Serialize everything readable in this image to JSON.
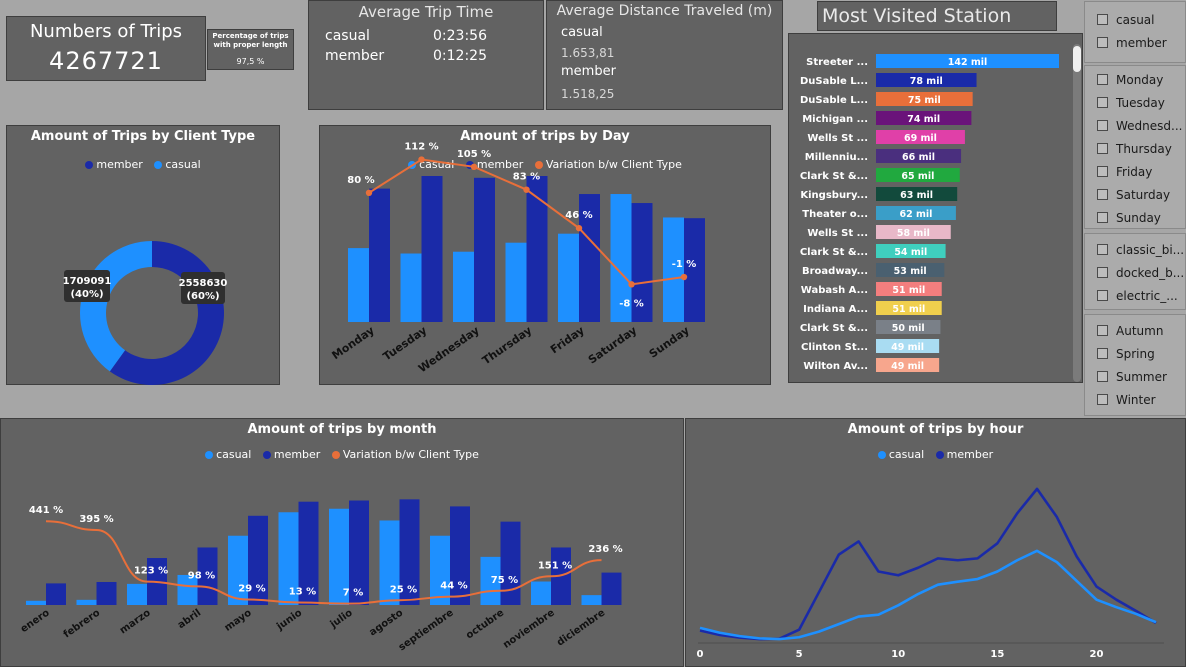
{
  "colors": {
    "casual": "#1e90ff",
    "member": "#1a2aa8",
    "variation": "#e86f3a",
    "panel": "#626262"
  },
  "kpi": {
    "trips_title": "Numbers of Trips",
    "trips_value": "4267721",
    "pct_label": "Percentage of trips with proper length",
    "pct_value": "97,5 %"
  },
  "avg_time": {
    "title": "Average Trip Time",
    "rows": [
      {
        "label": "casual",
        "value": "0:23:56"
      },
      {
        "label": "member",
        "value": "0:12:25"
      }
    ]
  },
  "avg_distance": {
    "title": "Average Distance Traveled (m)",
    "rows": [
      {
        "label": "casual",
        "value": "1.653,81"
      },
      {
        "label": "member",
        "value": "1.518,25"
      }
    ]
  },
  "stations_title": "Most Visited Station",
  "client_type": {
    "title": "Amount of Trips by Client Type",
    "legend": [
      "member",
      "casual"
    ],
    "member_label": "2558630",
    "member_pct": "(60%)",
    "casual_label": "1709091",
    "casual_pct": "(40%)"
  },
  "day_chart": {
    "title": "Amount of trips by Day",
    "legend": [
      "casual",
      "member",
      "Variation b/w Client Type"
    ],
    "categories": [
      "Monday",
      "Tuesday",
      "Wednesday",
      "Thursday",
      "Friday",
      "Saturday",
      "Sunday"
    ]
  },
  "month_chart": {
    "title": "Amount of trips by month",
    "legend": [
      "casual",
      "member",
      "Variation b/w Client Type"
    ],
    "categories": [
      "enero",
      "febrero",
      "marzo",
      "abril",
      "mayo",
      "junio",
      "julio",
      "agosto",
      "septiembre",
      "octubre",
      "noviembre",
      "diciembre"
    ]
  },
  "hour_chart": {
    "title": "Amount of trips by hour",
    "legend": [
      "casual",
      "member"
    ],
    "ticks": [
      "0",
      "5",
      "10",
      "15",
      "20"
    ]
  },
  "slicers": {
    "client": [
      "casual",
      "member"
    ],
    "days": [
      "Monday",
      "Tuesday",
      "Wednesd...",
      "Thursday",
      "Friday",
      "Saturday",
      "Sunday"
    ],
    "bikes": [
      "classic_bi...",
      "docked_b...",
      "electric_..."
    ],
    "seasons": [
      "Autumn",
      "Spring",
      "Summer",
      "Winter"
    ]
  },
  "chart_data": [
    {
      "type": "pie",
      "title": "Amount of Trips by Client Type",
      "labels": [
        "member",
        "casual"
      ],
      "values": [
        2558630,
        1709091
      ]
    },
    {
      "type": "bar",
      "title": "Amount of trips by Day",
      "categories": [
        "Monday",
        "Tuesday",
        "Wednesday",
        "Thursday",
        "Friday",
        "Saturday",
        "Sunday"
      ],
      "series": [
        {
          "name": "casual",
          "values": [
            205000,
            190000,
            195000,
            220000,
            245000,
            355000,
            290000
          ]
        },
        {
          "name": "member",
          "values": [
            370000,
            405000,
            400000,
            405000,
            355000,
            330000,
            288000
          ]
        },
        {
          "name": "Variation b/w Client Type",
          "values": [
            80,
            112,
            105,
            83,
            46,
            -8,
            -1
          ],
          "labels": [
            "80 %",
            "112 %",
            "105 %",
            "83 %",
            "46 %",
            "-8 %",
            "-1 %"
          ]
        }
      ]
    },
    {
      "type": "bar",
      "title": "Amount of trips by month",
      "categories": [
        "enero",
        "febrero",
        "marzo",
        "abril",
        "mayo",
        "junio",
        "julio",
        "agosto",
        "septiembre",
        "octubre",
        "noviembre",
        "diciembre"
      ],
      "series": [
        {
          "name": "casual",
          "values": [
            18000,
            22000,
            90000,
            128000,
            295000,
            395000,
            410000,
            360000,
            295000,
            205000,
            100000,
            42000
          ]
        },
        {
          "name": "member",
          "values": [
            92000,
            98000,
            200000,
            245000,
            380000,
            440000,
            445000,
            450000,
            420000,
            355000,
            245000,
            138000
          ]
        },
        {
          "name": "Variation b/w Client Type",
          "values": [
            441,
            395,
            123,
            98,
            29,
            13,
            7,
            25,
            44,
            75,
            151,
            236
          ],
          "labels": [
            "441 %",
            "395 %",
            "123 %",
            "98 %",
            "29 %",
            "13 %",
            "7 %",
            "25 %",
            "44 %",
            "75 %",
            "151 %",
            "236 %"
          ]
        }
      ]
    },
    {
      "type": "line",
      "title": "Amount of trips by hour",
      "x": [
        0,
        1,
        2,
        3,
        4,
        5,
        6,
        7,
        8,
        9,
        10,
        11,
        12,
        13,
        14,
        15,
        16,
        17,
        18,
        19,
        20,
        21,
        22,
        23
      ],
      "xlim": [
        0,
        23
      ],
      "series": [
        {
          "name": "casual",
          "values": [
            35000,
            22000,
            13000,
            7000,
            5000,
            10000,
            25000,
            45000,
            65000,
            70000,
            95000,
            125000,
            150000,
            158000,
            165000,
            185000,
            215000,
            240000,
            210000,
            160000,
            110000,
            90000,
            72000,
            50000
          ]
        },
        {
          "name": "member",
          "values": [
            28000,
            16000,
            9000,
            5000,
            6000,
            30000,
            130000,
            230000,
            265000,
            185000,
            175000,
            195000,
            220000,
            215000,
            220000,
            260000,
            340000,
            405000,
            330000,
            225000,
            145000,
            110000,
            80000,
            48000
          ]
        }
      ]
    },
    {
      "type": "bar",
      "title": "Most Visited Station",
      "categories": [
        "Streeter ...",
        "DuSable L...",
        "DuSable L...",
        "Michigan ...",
        "Wells St ...",
        "Millenniu...",
        "Clark St &...",
        "Kingsbury...",
        "Theater o...",
        "Wells St ...",
        "Clark St &...",
        "Broadway...",
        "Wabash A...",
        "Indiana A...",
        "Clark St &...",
        "Clinton St...",
        "Wilton Av..."
      ],
      "values": [
        142,
        78,
        75,
        74,
        69,
        66,
        65,
        63,
        62,
        58,
        54,
        53,
        51,
        51,
        50,
        49,
        49
      ],
      "labels": [
        "142 mil",
        "78 mil",
        "75 mil",
        "74 mil",
        "69 mil",
        "66 mil",
        "65 mil",
        "63 mil",
        "62 mil",
        "58 mil",
        "54 mil",
        "53 mil",
        "51 mil",
        "51 mil",
        "50 mil",
        "49 mil",
        "49 mil"
      ],
      "colors": [
        "#1e90ff",
        "#1a2aa8",
        "#e86f3a",
        "#6a137a",
        "#e040a8",
        "#4a2f7e",
        "#21a93f",
        "#124a3c",
        "#3a9ec8",
        "#e8b8c8",
        "#3fcfbe",
        "#4a6070",
        "#f47e7e",
        "#f0cf4d",
        "#7a8088",
        "#a9dcf2",
        "#f7a68d"
      ]
    }
  ]
}
